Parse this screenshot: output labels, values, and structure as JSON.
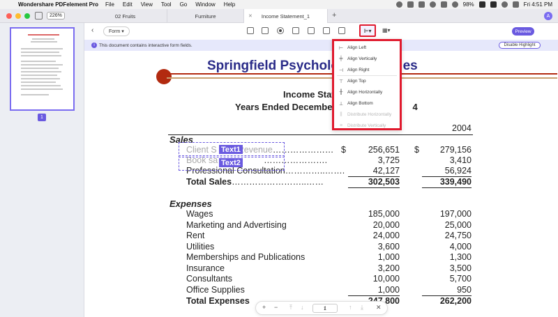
{
  "menubar": {
    "app_name": "Wondershare PDFelement Pro",
    "items": [
      "File",
      "Edit",
      "View",
      "Tool",
      "Go",
      "Window",
      "Help"
    ],
    "battery": "98%",
    "clock": "Fri 4:51 PM"
  },
  "tabbar": {
    "zoom": "226%",
    "tabs": [
      "02 Fruits",
      "Furniture",
      "Income Statement_1"
    ],
    "add": "+",
    "avatar": "A"
  },
  "sidebar": {
    "page_number": "1"
  },
  "toolbar": {
    "mode": "Form",
    "preview": "Preview"
  },
  "notice": {
    "text": "This document contains interactive form fields.",
    "disable_button": "Disable Highlight"
  },
  "align_menu": {
    "items": [
      {
        "label": "Align Left",
        "icon": "align-left-icon",
        "enabled": true
      },
      {
        "label": "Align Vertically",
        "icon": "align-vertical-icon",
        "enabled": true
      },
      {
        "label": "Align Right",
        "icon": "align-right-icon",
        "enabled": true
      },
      {
        "label": "Align Top",
        "icon": "align-top-icon",
        "enabled": true
      },
      {
        "label": "Align Horizontally",
        "icon": "align-horizontal-icon",
        "enabled": true
      },
      {
        "label": "Align Bottom",
        "icon": "align-bottom-icon",
        "enabled": true
      },
      {
        "label": "Distribute Horizontally",
        "icon": "distribute-horizontal-icon",
        "enabled": false
      },
      {
        "label": "Distribute Vertically",
        "icon": "distribute-vertical-icon",
        "enabled": false
      }
    ]
  },
  "document": {
    "title": "Springfield Psycholog",
    "title_tail": "es",
    "sub1": "Income Stat",
    "sub2": "Years Ended December",
    "sub2_tail": "4",
    "year_col": "2004",
    "sales_header": "Sales",
    "sales_rows": [
      {
        "label": "Client S",
        "label_tail": "Revenue",
        "dots": "…………………",
        "dollar": true,
        "v1": "256,651",
        "v2": "279,156"
      },
      {
        "label": "Book sa",
        "dots": "………………….",
        "v1": "3,725",
        "v2": "3,410"
      },
      {
        "label": "Professional Consultation",
        "dots": "…………..…….",
        "v1": "42,127",
        "v2": "56,924"
      }
    ],
    "sales_total": {
      "label": "Total Sales",
      "dots": "……………………..……",
      "v1": "302,503",
      "v2": "339,490"
    },
    "field_tags": [
      "Text1",
      "Text2"
    ],
    "expenses_header": "Expenses",
    "expense_rows": [
      {
        "label": "Wages",
        "v1": "185,000",
        "v2": "197,000"
      },
      {
        "label": "Marketing and Advertising",
        "v1": "20,000",
        "v2": "25,000"
      },
      {
        "label": "Rent",
        "v1": "24,000",
        "v2": "24,750"
      },
      {
        "label": "Utilities",
        "v1": "3,600",
        "v2": "4,000"
      },
      {
        "label": "Memberships and Publications",
        "v1": "1,000",
        "v2": "1,300"
      },
      {
        "label": "Insurance",
        "v1": "3,200",
        "v2": "3,500"
      },
      {
        "label": "Consultants",
        "v1": "10,000",
        "v2": "5,700"
      },
      {
        "label": "Office Supplies",
        "v1": "1,000",
        "v2": "950"
      }
    ],
    "expenses_total": {
      "label": "Total Expenses",
      "v1": "247,800",
      "v2": "262,200"
    }
  },
  "bottom_nav": {
    "zoom_in": "+",
    "zoom_out": "−",
    "page": "1",
    "sep": "/",
    "total": "1",
    "close": "✕"
  }
}
